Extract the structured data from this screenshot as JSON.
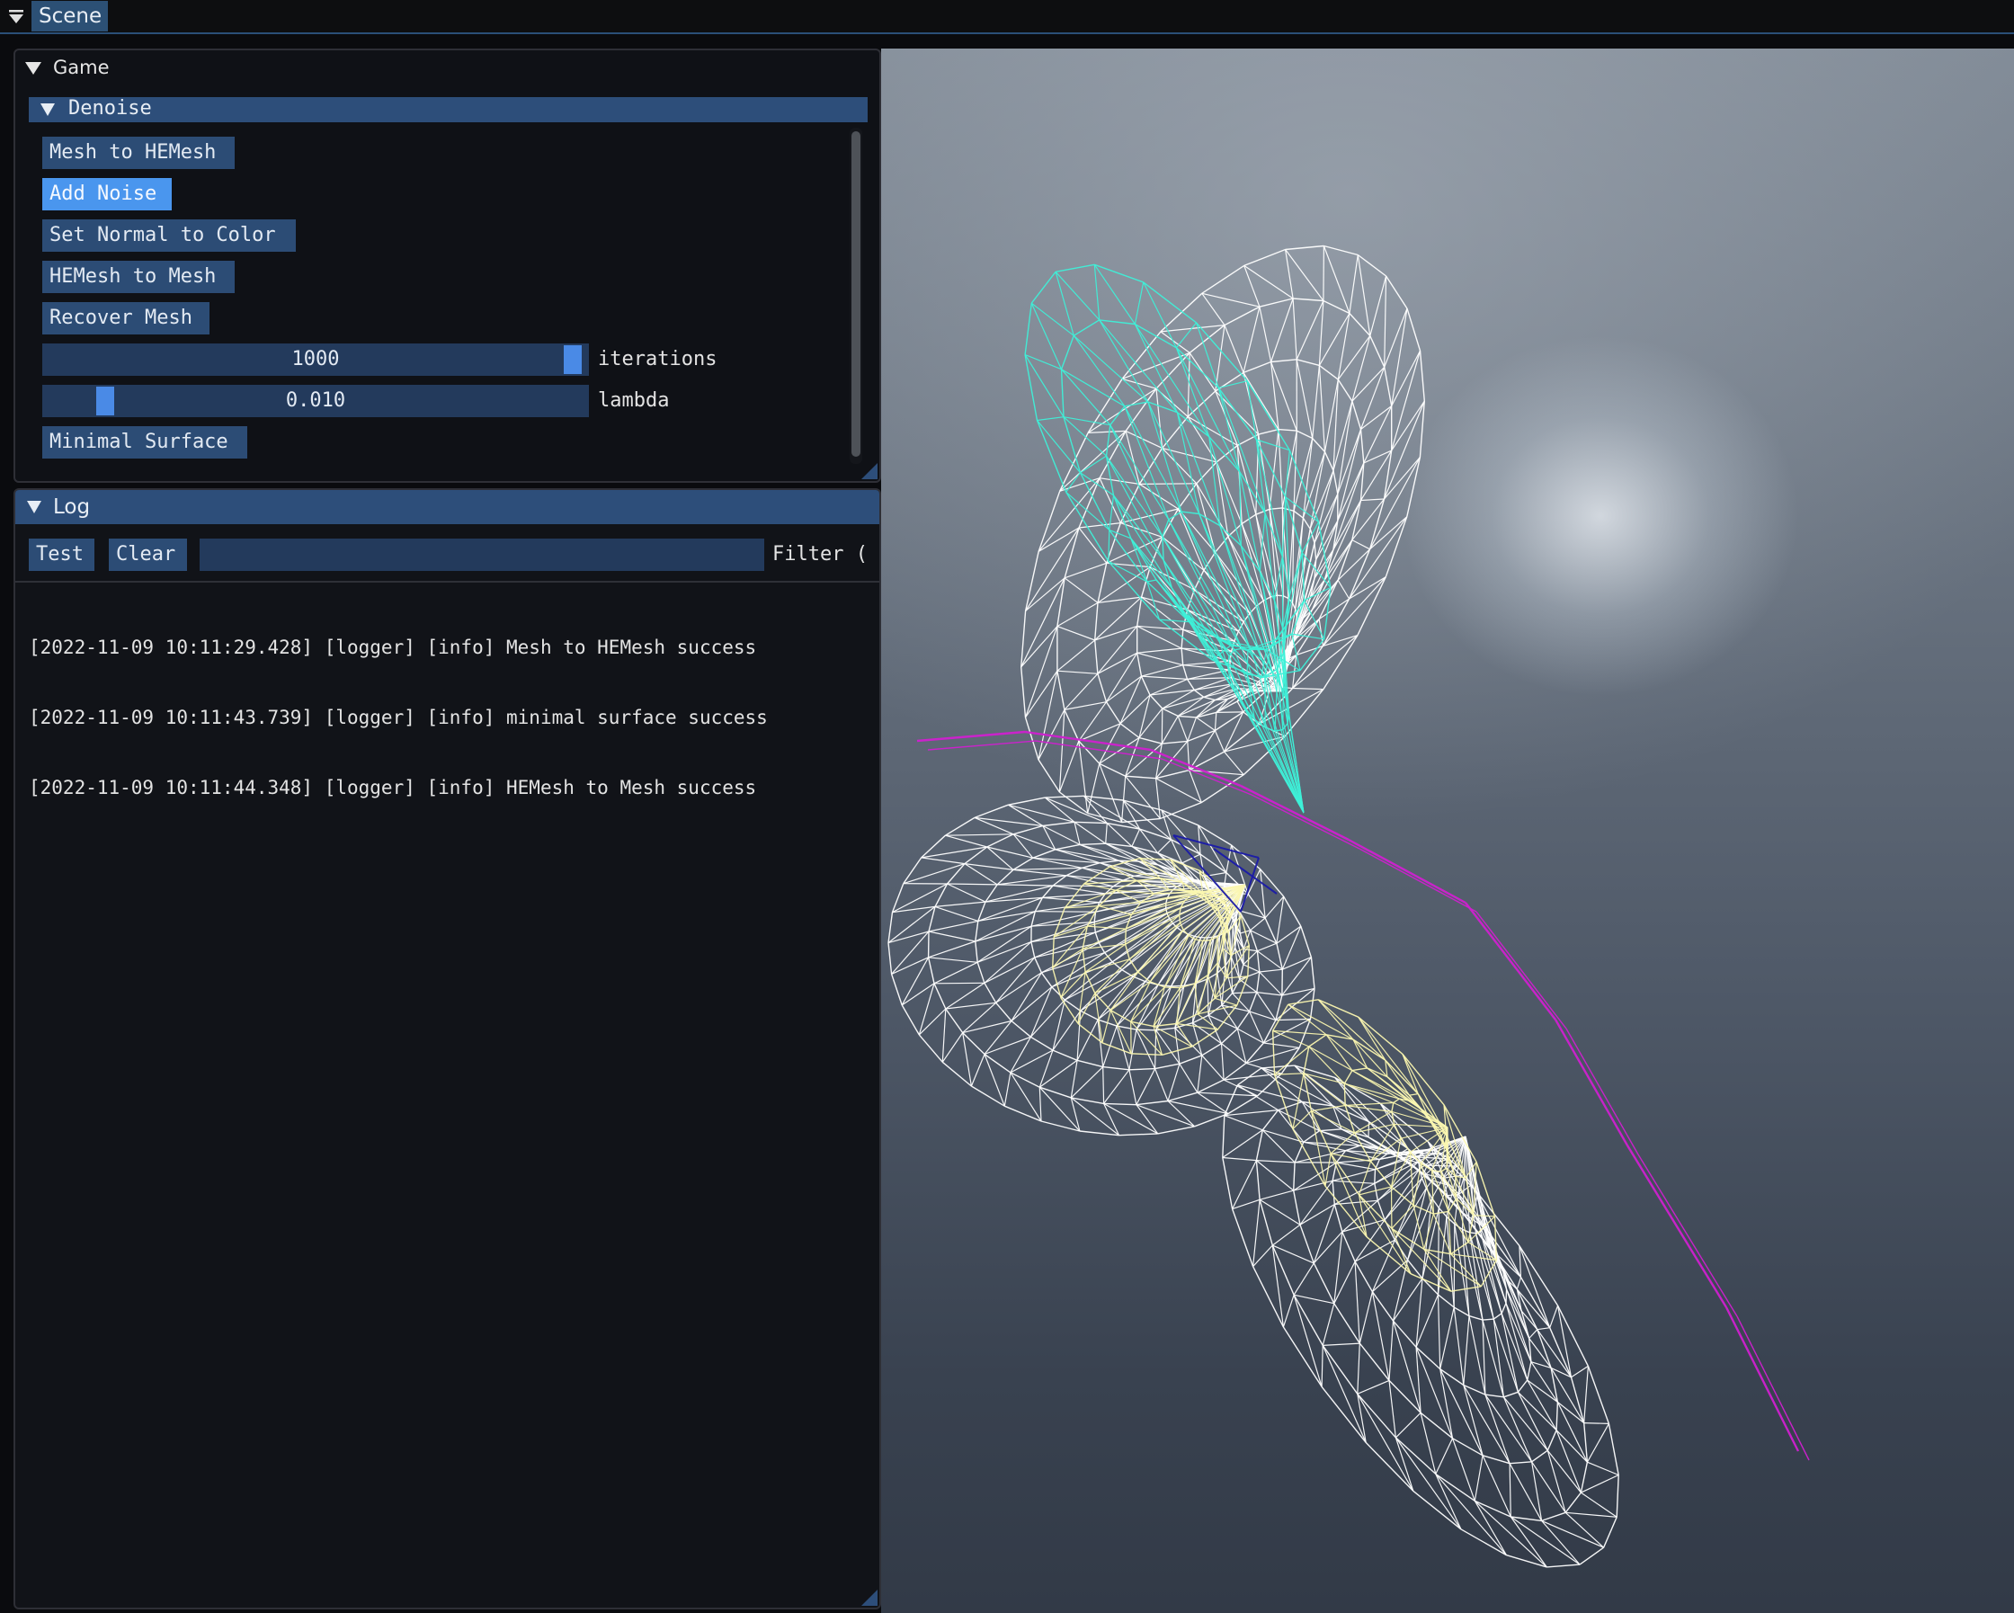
{
  "menubar": {
    "tab_label": "Scene"
  },
  "game_window": {
    "title": "Game",
    "section": {
      "title": "Denoise",
      "buttons": {
        "mesh_to_hemesh": "Mesh to HEMesh",
        "add_noise": "Add Noise",
        "set_normal_to_color": "Set Normal to Color",
        "hemesh_to_mesh": "HEMesh to Mesh",
        "recover_mesh": "Recover Mesh",
        "minimal_surface": "Minimal Surface"
      },
      "iterations": {
        "value": "1000",
        "label": "iterations",
        "fraction": 0.99
      },
      "lambda": {
        "value": "0.010",
        "label": "lambda",
        "fraction": 0.1
      }
    }
  },
  "log_window": {
    "title": "Log",
    "test_label": "Test",
    "clear_label": "Clear",
    "filter_value": "",
    "filter_label": "Filter (",
    "lines": [
      "[2022-11-09 10:11:29.428] [logger] [info] Mesh to HEMesh success",
      "[2022-11-09 10:11:43.739] [logger] [info] minimal surface success",
      "[2022-11-09 10:11:44.348] [logger] [info] HEMesh to Mesh success"
    ]
  },
  "colors": {
    "accent": "#4a96ee",
    "header_blue": "#2d4e7a",
    "button_blue": "#2c4c75",
    "wire_white": "#ffffff",
    "wire_cyan": "#3ef0d8",
    "wire_magenta": "#d020d0",
    "wire_yellow": "#fbf7b0",
    "wire_navy": "#1a1aa8"
  },
  "icons": {
    "collapse": "triangle-down-icon",
    "resize": "resize-grip-icon"
  }
}
